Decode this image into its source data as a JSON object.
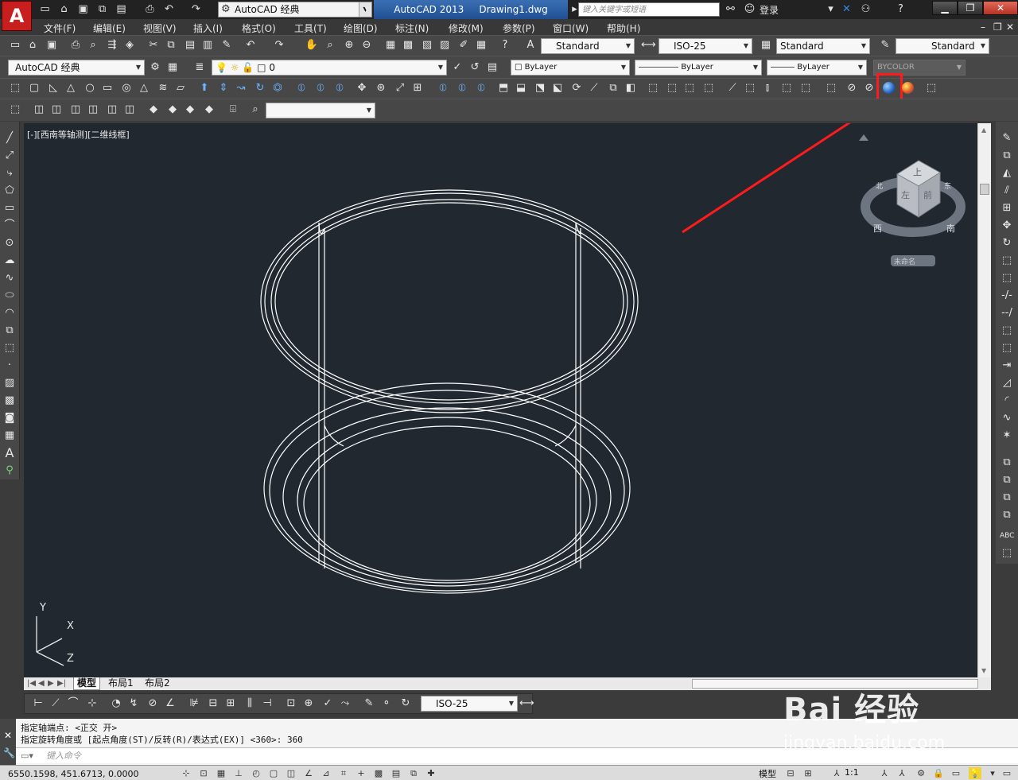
{
  "titlebar": {
    "app_logo": "A",
    "workspace": "AutoCAD 经典",
    "app_name": "AutoCAD 2013",
    "document": "Drawing1.dwg",
    "search_placeholder": "键入关键字或短语",
    "signin": "登录"
  },
  "menubar": {
    "items": [
      "文件(F)",
      "编辑(E)",
      "视图(V)",
      "插入(I)",
      "格式(O)",
      "工具(T)",
      "绘图(D)",
      "标注(N)",
      "修改(M)",
      "参数(P)",
      "窗口(W)",
      "帮助(H)"
    ]
  },
  "styles_toolbar": {
    "text_style": "Standard",
    "dim_style": "ISO-25",
    "table_style": "Standard",
    "multileader_style": "Standard"
  },
  "layers_toolbar": {
    "workspace": "AutoCAD 经典",
    "layer": "0",
    "color": "ByLayer",
    "linetype": "ByLayer",
    "lineweight": "ByLayer",
    "plot_style": "BYCOLOR"
  },
  "drawing": {
    "viewport_label": "[-][西南等轴测][二维线框]",
    "ucs_labels": {
      "y": "Y",
      "x": "X",
      "z": "Z"
    },
    "viewcube": {
      "face_top": "上",
      "face_front": "左",
      "face_right": "前",
      "compass_w": "西",
      "compass_s": "南",
      "compass_n": "北",
      "compass_e": "东",
      "ucs_menu": "未命名"
    }
  },
  "layout_tabs": [
    "模型",
    "布局1",
    "布局2"
  ],
  "dim_toolbar": {
    "dim_style": "ISO-25"
  },
  "command": {
    "history": [
      "指定轴端点: <正交 开>",
      "指定旋转角度或 [起点角度(ST)/反转(R)/表达式(EX)] <360>: 360"
    ],
    "input_placeholder": "键入命令"
  },
  "status": {
    "coordinates": "6550.1598, 451.6713, 0.0000",
    "model_label": "模型",
    "annotation_scale": "1:1"
  },
  "watermark": {
    "brand": "Bai 经验",
    "url": "jingyan.baidu.com"
  },
  "colors": {
    "canvas": "#212830",
    "highlight": "#ff1b1b",
    "title_active": "#2a5fa7"
  }
}
